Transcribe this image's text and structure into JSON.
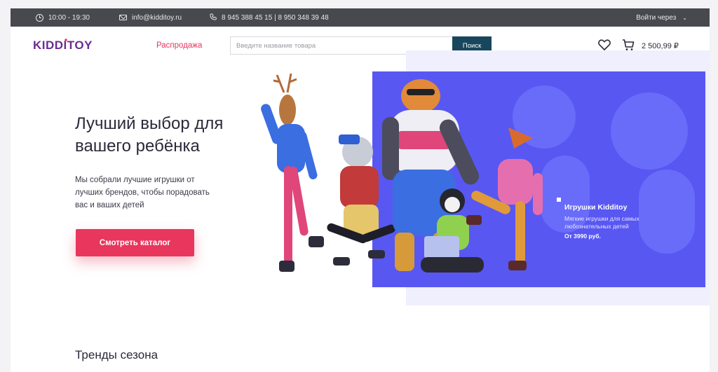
{
  "topbar": {
    "hours": "10:00 - 19:30",
    "email": "info@kidditoy.ru",
    "phones": "8 945 388 45 15 | 8 950 348 39 48",
    "login_label": "Войти через"
  },
  "header": {
    "logo_text": "KIDDITOY",
    "sale_link": "Распродажа",
    "search_placeholder": "Введите название товара",
    "search_button": "Поиск",
    "cart_total": "2 500,99 ₽"
  },
  "hero": {
    "title": "Лучший выбор для вашего ребёнка",
    "subtitle": "Мы собрали лучшие игрушки от лучших брендов, чтобы порадовать вас и ваших детей",
    "cta_label": "Смотреть каталог"
  },
  "promo": {
    "title": "Игрушки Kidditoy",
    "subtitle": "Мягкие игрушки для самых любознательных детей",
    "price": "От 3990 руб."
  },
  "section": {
    "trends_title": "Тренды сезона"
  },
  "colors": {
    "accent": "#e8365d",
    "topbar_bg": "#47494e",
    "search_btn": "#18475d",
    "panel_blue": "#5857f2",
    "logo_purple": "#6b2c91"
  },
  "icons": [
    "clock-icon",
    "mail-icon",
    "phone-icon",
    "chevron-down-icon",
    "heart-icon",
    "cart-icon"
  ]
}
